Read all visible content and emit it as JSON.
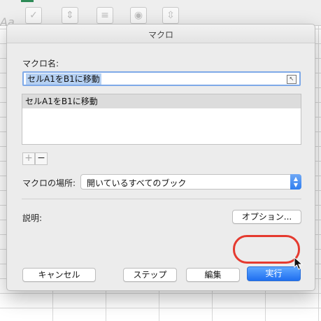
{
  "dialog": {
    "title": "マクロ",
    "macro_name_label": "マクロ名:",
    "macro_name_value": "セルA1をB1に移動",
    "macro_list": [
      "セルA1をB1に移動"
    ],
    "add_button": "+",
    "remove_button": "−",
    "location_label": "マクロの場所:",
    "location_value": "開いているすべてのブック",
    "description_label": "説明:",
    "options_button": "オプション...",
    "cancel_button": "キャンセル",
    "step_button": "ステップ",
    "edit_button": "編集",
    "run_button": "実行"
  },
  "colors": {
    "primary_button": "#1f6ff0",
    "highlight_ring": "#e53a2f",
    "selection": "#b5d0f2"
  }
}
